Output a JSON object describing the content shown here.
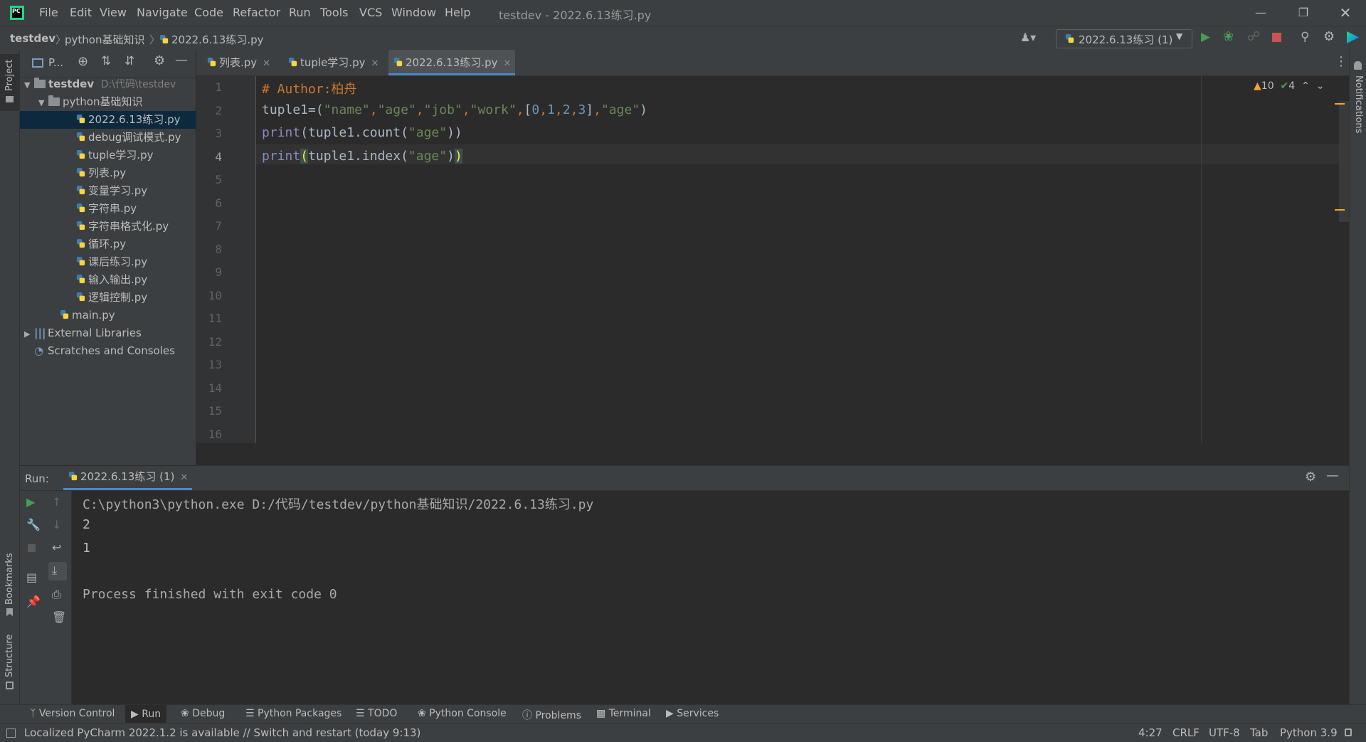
{
  "titlebar": {
    "menu": [
      "File",
      "Edit",
      "View",
      "Navigate",
      "Code",
      "Refactor",
      "Run",
      "Tools",
      "VCS",
      "Window",
      "Help"
    ],
    "title": "testdev - 2022.6.13练习.py"
  },
  "navbar": {
    "crumbs": [
      "testdev",
      "python基础知识",
      "2022.6.13练习.py"
    ],
    "run_config": "2022.6.13练习 (1)"
  },
  "left_strip": {
    "project": "Project",
    "bookmarks": "Bookmarks",
    "structure": "Structure"
  },
  "right_strip": {
    "notifications": "Notifications"
  },
  "project": {
    "header": "P...",
    "root_name": "testdev",
    "root_path": "D:\\代码\\testdev",
    "folder": "python基础知识",
    "files": [
      "2022.6.13练习.py",
      "debug调试模式.py",
      "tuple学习.py",
      "列表.py",
      "变量学习.py",
      "字符串.py",
      "字符串格式化.py",
      "循环.py",
      "课后练习.py",
      "输入输出.py",
      "逻辑控制.py"
    ],
    "main": "main.py",
    "external": "External Libraries",
    "scratches": "Scratches and Consoles"
  },
  "tabs": [
    "列表.py",
    "tuple学习.py",
    "2022.6.13练习.py"
  ],
  "editor": {
    "line_numbers": [
      "1",
      "2",
      "3",
      "4",
      "5",
      "6",
      "7",
      "8",
      "9",
      "10",
      "11",
      "12",
      "13",
      "14",
      "15",
      "16"
    ],
    "line1_hash": "# Author:",
    "line1_name": "柏舟",
    "line2_var": "tuple1",
    "line2_eq": "=",
    "line2_open": "(",
    "s_name": "\"name\"",
    "s_age": "\"age\"",
    "s_job": "\"job\"",
    "s_work": "\"work\"",
    "comma": ",",
    "lbr": "[",
    "rbr": "]",
    "n0": "0",
    "n1": "1",
    "n2": "2",
    "n3": "3",
    "close": ")",
    "print": "print",
    "line3_mid": "(tuple1.count(",
    "line3_end": "))",
    "line4_open": "(",
    "line4_mid": "tuple1.index(",
    "line4_close1": ")",
    "line4_close2": ")",
    "warnings": "10",
    "checks": "4"
  },
  "run": {
    "label": "Run:",
    "tab": "2022.6.13练习 (1)",
    "output": [
      "C:\\python3\\python.exe D:/代码/testdev/python基础知识/2022.6.13练习.py",
      "2",
      "1",
      "",
      "Process finished with exit code 0"
    ]
  },
  "bottom_tools": [
    "Version Control",
    "Run",
    "Debug",
    "Python Packages",
    "TODO",
    "Python Console",
    "Problems",
    "Terminal",
    "Services"
  ],
  "status": {
    "message": "Localized PyCharm 2022.1.2 is available // Switch and restart (today 9:13)",
    "position": "4:27",
    "line_sep": "CRLF",
    "encoding": "UTF-8",
    "indent": "Tab",
    "interpreter": "Python 3.9"
  },
  "colors": {
    "accent": "#4a88c7",
    "run_green": "#499c54",
    "stop_red": "#c75450",
    "comment": "#cc7832",
    "string": "#6a8759",
    "number": "#6897bb"
  }
}
